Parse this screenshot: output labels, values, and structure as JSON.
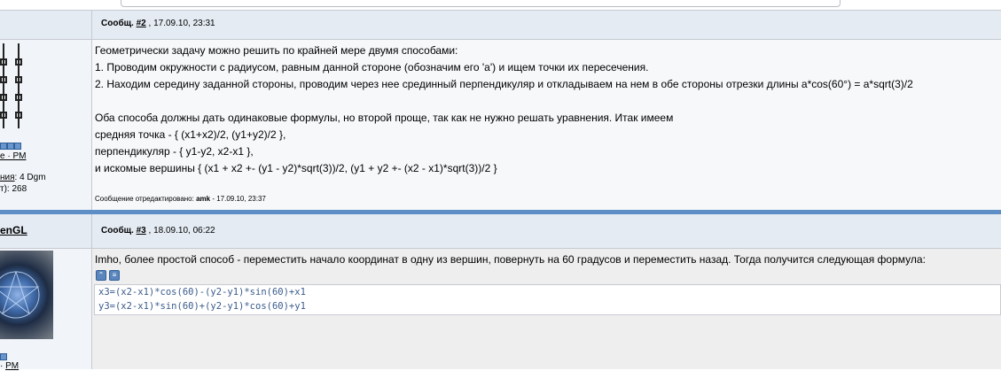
{
  "post2": {
    "header_label": "Сообщ.",
    "number": "#2",
    "date": ", 17.09.10, 23:31",
    "side_status": "e · PM",
    "side_rating_label": "ния",
    "side_rating_value": ": 4 Dgm",
    "side_posts_label": "т): 268",
    "lines": [
      "Геометрически задачу можно решить по крайней мере двумя способами:",
      "1. Проводим окружности с радиусом, равным данной стороне (обозначим его 'a') и ищем точки их пересечения.",
      "2. Находим середину заданной стороны, проводим через нее срединный перпендикуляр и откладываем на нем в обе стороны отрезки длины a*cos(60°) = a*sqrt(3)/2",
      "Оба способа должны дать одинаковые формулы, но второй проще, так как не нужно решать уравнения. Итак имеем",
      "средняя точка - { (x1+x2)/2, (y1+y2)/2 },",
      "перпендикуляр - { y1-y2, x2-x1 },",
      "и искомые вершины { (x1 + x2 +- (y1 - y2)*sqrt(3))/2, (y1 + y2 +- (x2 - x1)*sqrt(3))/2 }"
    ],
    "edit_prefix": "Сообщение отредактировано:",
    "edit_user": "amk",
    "edit_date": "- 17.09.10, 23:37"
  },
  "post3": {
    "author": "enGL",
    "header_label": "Сообщ.",
    "number": "#3",
    "date": ", 18.09.10, 06:22",
    "side_pm": "PM",
    "text": "Imho, более простой способ - переместить начало координат в одну из вершин, повернуть на 60 градусов и переместить назад. Тогда получится следующая формула:",
    "code": [
      "x3=(x2-x1)*cos(60)-(y2-y1)*sin(60)+x1",
      "y3=(x2-x1)*sin(60)+(y2-y1)*cos(60)+y1"
    ]
  },
  "colors": {
    "header_bg": "#e4ebf3",
    "separator": "#5d8ec6",
    "code_text": "#3a5b8c"
  }
}
